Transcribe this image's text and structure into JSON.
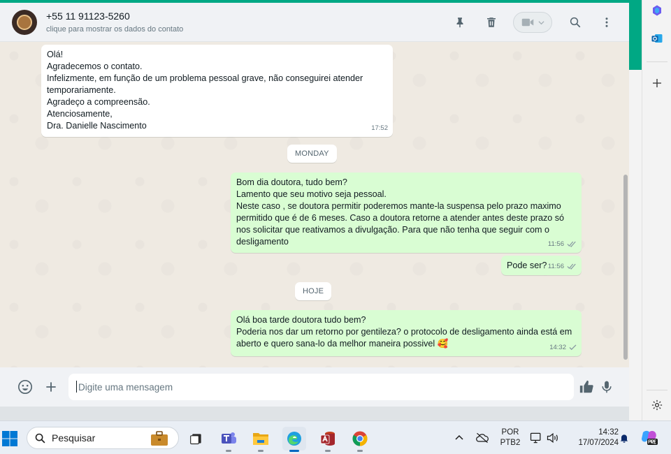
{
  "header": {
    "contact_name": "+55 11 91123-5260",
    "contact_subtitle": "clique para mostrar os dados do contato"
  },
  "messages": [
    {
      "direction": "incoming",
      "text": "Olá!\nAgradecemos o contato.\nInfelizmente, em função de um problema pessoal grave, não conseguirei atender temporariamente.\nAgradeço a compreensão.\nAtenciosamente,\nDra. Danielle Nascimento",
      "time": "17:52"
    },
    {
      "direction": "outgoing",
      "text": "Bom dia doutora, tudo bem?\nLamento que seu motivo seja pessoal.\nNeste caso , se doutora permitir poderemos mante-la suspensa pelo prazo maximo permitido que é de 6 meses. Caso a doutora retorne a atender antes deste prazo só nos solicitar que reativamos a divulgação. Para que não tenha que seguir com o desligamento",
      "time": "11:56",
      "status": "read"
    },
    {
      "direction": "outgoing",
      "text": "Pode ser?",
      "time": "11:56",
      "status": "read"
    },
    {
      "direction": "outgoing",
      "text": "Olá boa tarde doutora tudo bem?\nPoderia nos dar um retorno por gentileza? o protocolo de desligamento ainda está em aberto e quero sana-lo da melhor maneira possivel 🥰",
      "time": "14:32",
      "status": "sent"
    }
  ],
  "day_separators": {
    "monday": "MONDAY",
    "today": "HOJE"
  },
  "composer": {
    "placeholder": "Digite uma mensagem"
  },
  "taskbar": {
    "search_label": "Pesquisar",
    "language_line1": "POR",
    "language_line2": "PTB2",
    "time": "14:32",
    "date": "17/07/2024"
  },
  "colors": {
    "accent": "#00a884",
    "incoming_bubble": "#ffffff",
    "outgoing_bubble": "#d9fdd3",
    "chat_background": "#efeae2"
  },
  "icons": {
    "header": [
      "pin-icon",
      "trash-icon",
      "video-call-icon",
      "search-icon",
      "menu-icon"
    ],
    "composer": [
      "emoji-icon",
      "plus-icon",
      "thumbs-up-icon",
      "microphone-icon"
    ]
  }
}
